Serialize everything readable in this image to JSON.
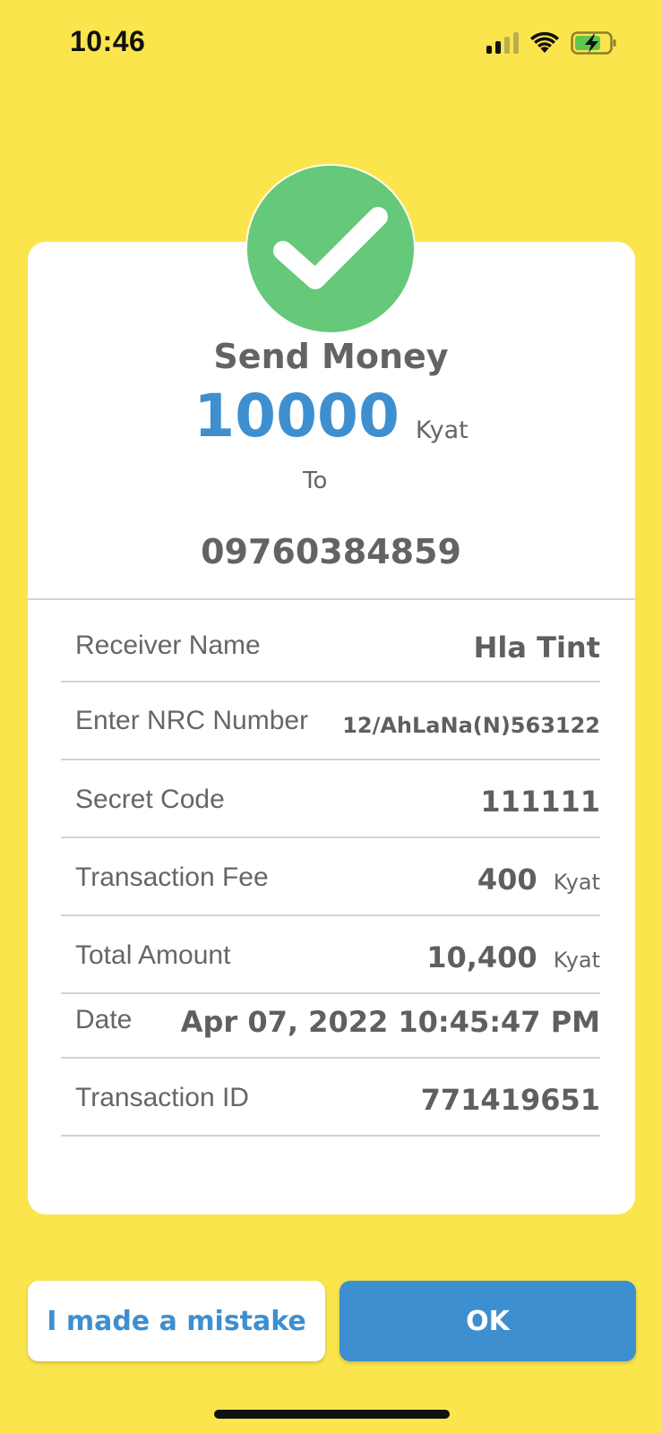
{
  "status_bar": {
    "time": "10:46"
  },
  "result": {
    "title": "Send Money",
    "amount": "10000",
    "amount_unit": "Kyat",
    "to_label": "To",
    "recipient_phone": "09760384859"
  },
  "details": [
    {
      "label": "Receiver Name",
      "value": "Hla Tint",
      "unit": ""
    },
    {
      "label": "Enter NRC Number",
      "value": "12/AhLaNa(N)563122",
      "unit": ""
    },
    {
      "label": "Secret Code",
      "value": "111111",
      "unit": ""
    },
    {
      "label": "Transaction Fee",
      "value": "400",
      "unit": "Kyat"
    },
    {
      "label": "Total Amount",
      "value": "10,400",
      "unit": "Kyat"
    },
    {
      "label": "Date",
      "value": "Apr 07, 2022 10:45:47 PM",
      "unit": ""
    },
    {
      "label": "Transaction ID",
      "value": "771419651",
      "unit": ""
    }
  ],
  "buttons": {
    "mistake_label": "I made a mistake",
    "ok_label": "OK"
  },
  "colors": {
    "background": "#fbe54d",
    "accent_blue": "#3d8fd0",
    "success_green": "#66c879"
  },
  "icons": {
    "success": "checkmark-icon",
    "signal": "cellular-signal-icon",
    "wifi": "wifi-icon",
    "battery": "battery-charging-icon"
  }
}
